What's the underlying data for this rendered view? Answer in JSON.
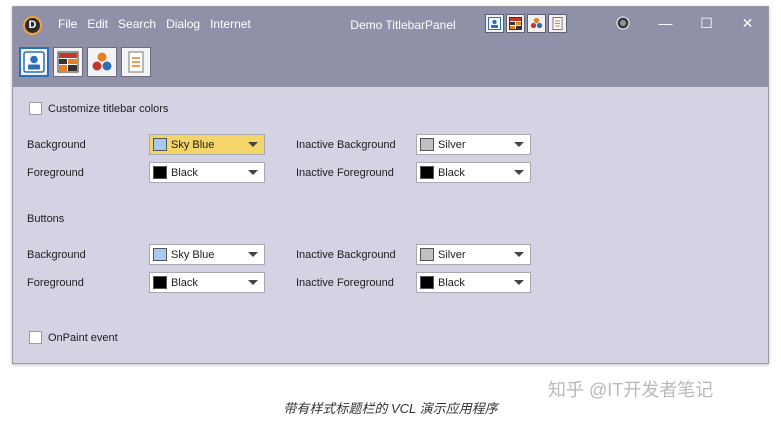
{
  "titlebar": {
    "logo_letter": "D",
    "menu": [
      "File",
      "Edit",
      "Search",
      "Dialog",
      "Internet"
    ],
    "title": "Demo TitlebarPanel",
    "icons": [
      "dashboard-icon",
      "grid-report-icon",
      "color-palette-icon",
      "document-list-icon"
    ],
    "controls": {
      "target": "◎",
      "minimize": "—",
      "maximize": "☐",
      "close": "✕"
    }
  },
  "toolbar": {
    "icons": [
      "dashboard-icon",
      "grid-report-icon",
      "color-palette-icon",
      "document-list-icon"
    ]
  },
  "options": {
    "customize_label": "Customize titlebar colors",
    "onpaint_label": "OnPaint event"
  },
  "titlebar_colors": {
    "background_label": "Background",
    "foreground_label": "Foreground",
    "inactive_background_label": "Inactive Background",
    "inactive_foreground_label": "Inactive Foreground",
    "background": {
      "value": "Sky Blue",
      "color": "#a6caf0"
    },
    "foreground": {
      "value": "Black",
      "color": "#000000"
    },
    "inactive_background": {
      "value": "Silver",
      "color": "#c0c0c0"
    },
    "inactive_foreground": {
      "value": "Black",
      "color": "#000000"
    }
  },
  "buttons_section": {
    "heading": "Buttons",
    "background_label": "Background",
    "foreground_label": "Foreground",
    "inactive_background_label": "Inactive Background",
    "inactive_foreground_label": "Inactive Foreground",
    "background": {
      "value": "Sky Blue",
      "color": "#a6caf0"
    },
    "foreground": {
      "value": "Black",
      "color": "#000000"
    },
    "inactive_background": {
      "value": "Silver",
      "color": "#c0c0c0"
    },
    "inactive_foreground": {
      "value": "Black",
      "color": "#000000"
    }
  },
  "caption": "带有样式标题栏的 VCL 演示应用程序",
  "watermark": "知乎 @IT开发者笔记"
}
